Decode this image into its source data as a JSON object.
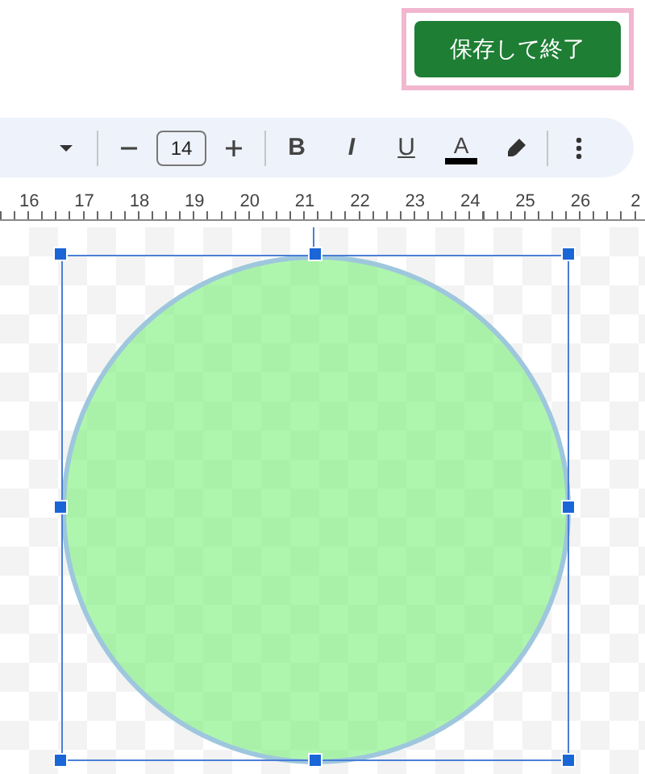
{
  "header": {
    "save_button": "保存して終了"
  },
  "toolbar": {
    "font_size": "14",
    "format_buttons": [
      {
        "kind": "bold",
        "label": "B"
      },
      {
        "kind": "italic",
        "label": "I"
      },
      {
        "kind": "underline",
        "label": "U"
      },
      {
        "kind": "text-color",
        "label": "A"
      }
    ]
  },
  "ruler": {
    "labels": [
      "16",
      "17",
      "18",
      "19",
      "20",
      "21",
      "22",
      "23",
      "24",
      "25",
      "26",
      "2"
    ]
  },
  "canvas": {
    "shape": {
      "kind": "circle",
      "selected": true
    }
  }
}
